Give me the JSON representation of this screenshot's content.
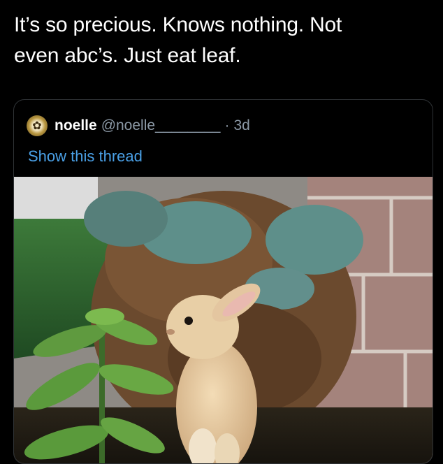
{
  "tweet": {
    "text_line1": "It’s so precious. Knows nothing. Not",
    "text_line2": "even abc’s. Just eat leaf."
  },
  "quoted_tweet": {
    "display_name": "noelle",
    "handle": "@noelle________",
    "separator": "·",
    "time": "3d",
    "show_thread_label": "Show this thread",
    "avatar_icon": "flower-avatar-icon"
  },
  "colors": {
    "background": "#000000",
    "text": "#ffffff",
    "muted": "#8b98a5",
    "link": "#4aa0e6",
    "card_border": "#2f3336"
  },
  "media": {
    "subject": "rabbit-photo"
  }
}
